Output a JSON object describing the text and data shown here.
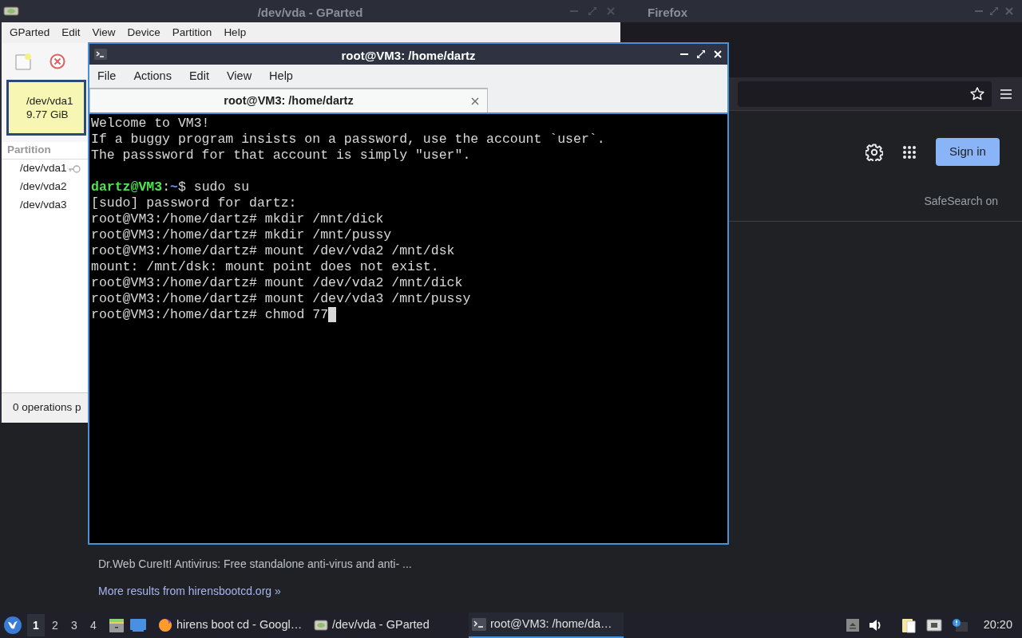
{
  "firefox": {
    "title": "Firefox",
    "sign_in": "Sign in",
    "safesearch": "SafeSearch on",
    "results": [
      {
        "snippet": "Dr.Web CureIt! Antivirus: Free standalone anti-virus and anti- ..."
      }
    ],
    "more_results": "More results from hirensbootcd.org »"
  },
  "gparted": {
    "title": "/dev/vda - GParted",
    "menu": [
      "GParted",
      "Edit",
      "View",
      "Device",
      "Partition",
      "Help"
    ],
    "disk_graph": {
      "name": "/dev/vda1",
      "size": "9.77 GiB"
    },
    "partition_column": "Partition",
    "partitions": [
      {
        "name": "/dev/vda1",
        "mounted": true
      },
      {
        "name": "/dev/vda2",
        "mounted": false
      },
      {
        "name": "/dev/vda3",
        "mounted": false
      }
    ],
    "status": "0 operations p"
  },
  "terminal": {
    "title": "root@VM3: /home/dartz",
    "menu": [
      "File",
      "Actions",
      "Edit",
      "View",
      "Help"
    ],
    "tabs": [
      {
        "label": "root@VM3: /home/dartz",
        "selected": true
      }
    ],
    "lines": [
      {
        "segments": [
          {
            "kind": "plain",
            "text": "Welcome to VM3!"
          }
        ]
      },
      {
        "segments": [
          {
            "kind": "plain",
            "text": "If a buggy program insists on a password, use the account `user`."
          }
        ]
      },
      {
        "segments": [
          {
            "kind": "plain",
            "text": "The passsword for that account is simply \"user\"."
          }
        ]
      },
      {
        "gap_before": true,
        "segments": [
          {
            "kind": "user",
            "text": "dartz@VM3"
          },
          {
            "kind": "plain",
            "text": ":"
          },
          {
            "kind": "path",
            "text": "~"
          },
          {
            "kind": "plain",
            "text": "$ sudo su"
          }
        ]
      },
      {
        "segments": [
          {
            "kind": "plain",
            "text": "[sudo] password for dartz:"
          }
        ]
      },
      {
        "segments": [
          {
            "kind": "plain",
            "text": "root@VM3:/home/dartz# mkdir /mnt/dick"
          }
        ]
      },
      {
        "segments": [
          {
            "kind": "plain",
            "text": "root@VM3:/home/dartz# mkdir /mnt/pussy"
          }
        ]
      },
      {
        "segments": [
          {
            "kind": "plain",
            "text": "root@VM3:/home/dartz# mount /dev/vda2 /mnt/dsk"
          }
        ]
      },
      {
        "segments": [
          {
            "kind": "plain",
            "text": "mount: /mnt/dsk: mount point does not exist."
          }
        ]
      },
      {
        "segments": [
          {
            "kind": "plain",
            "text": "root@VM3:/home/dartz# mount /dev/vda2 /mnt/dick"
          }
        ]
      },
      {
        "segments": [
          {
            "kind": "plain",
            "text": "root@VM3:/home/dartz# mount /dev/vda3 /mnt/pussy"
          }
        ]
      },
      {
        "cursor": true,
        "segments": [
          {
            "kind": "plain",
            "text": "root@VM3:/home/dartz# chmod 77"
          }
        ]
      }
    ]
  },
  "taskbar": {
    "desktops": [
      {
        "label": "1",
        "selected": true
      },
      {
        "label": "2",
        "selected": false
      },
      {
        "label": "3",
        "selected": false
      },
      {
        "label": "4",
        "selected": false
      }
    ],
    "tasks": [
      {
        "kind": "browser",
        "label": "hirens boot cd - Googl…",
        "selected": false
      },
      {
        "kind": "disk",
        "label": "/dev/vda - GParted",
        "selected": false
      },
      {
        "kind": "terminal",
        "label": "root@VM3: /home/da…",
        "selected": true
      }
    ],
    "clock": "20:20"
  }
}
